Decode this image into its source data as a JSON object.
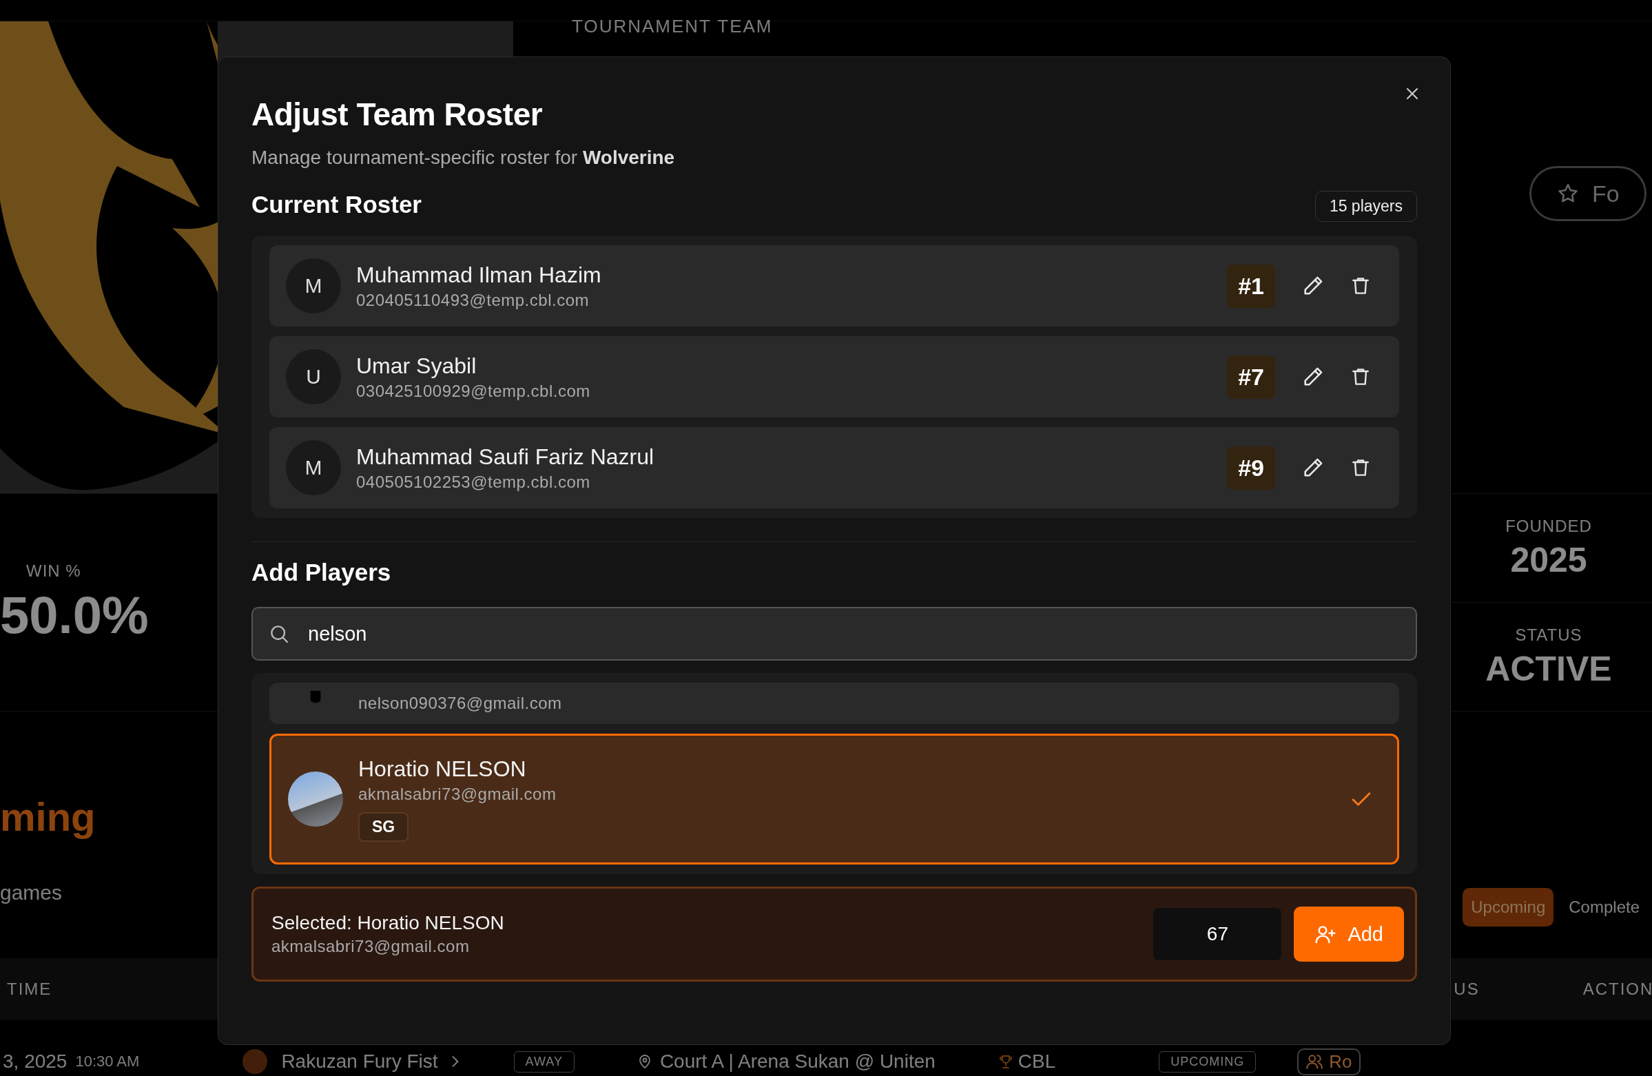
{
  "background": {
    "header_label": "TOURNAMENT TEAM",
    "follow_button": "Fo",
    "stats": [
      {
        "label": "WIN %",
        "value": "50.0%"
      },
      {
        "label": "FOUNDED",
        "value": "2025"
      },
      {
        "label": "STATUS",
        "value": "ACTIVE"
      }
    ],
    "games_heading": "ming",
    "games_subtitle": "games",
    "filter_tabs": [
      {
        "label": "Upcoming",
        "selected": true
      },
      {
        "label": "Complete",
        "selected": false
      }
    ],
    "table": {
      "columns": [
        "TIME",
        "US",
        "ACTION"
      ],
      "rows": [
        {
          "date": "3, 2025",
          "time": "10:30 AM",
          "opponent": "Rakuzan Fury Fist",
          "venue_type": "AWAY",
          "venue": "Court A | Arena Sukan @ Uniten",
          "league": "CBL",
          "status": "UPCOMING",
          "action": "Ro"
        }
      ]
    }
  },
  "dialog": {
    "title": "Adjust Team Roster",
    "subtitle": "Manage tournament-specific roster for **Wolverine**",
    "roster_heading": "Current Roster",
    "player_count": "15 players",
    "roster": [
      {
        "initial": "M",
        "name": "Muhammad Ilman Hazim",
        "email": "020405110493@temp.cbl.com",
        "number": "#1"
      },
      {
        "initial": "U",
        "name": "Umar Syabil",
        "email": "030425100929@temp.cbl.com",
        "number": "#7"
      },
      {
        "initial": "M",
        "name": "Muhammad Saufi Fariz Nazrul",
        "email": "040505102253@temp.cbl.com",
        "number": "#9"
      }
    ],
    "add_heading": "Add Players",
    "search": {
      "value": "nelson"
    },
    "results": [
      {
        "kind": "silhouette",
        "email": "nelson090376@gmail.com",
        "selected": false
      },
      {
        "kind": "photo",
        "name": "Horatio NELSON",
        "email": "akmalsabri73@gmail.com",
        "position": "SG",
        "selected": true
      }
    ],
    "selection": {
      "label": "Selected: Horatio NELSON",
      "email": "akmalsabri73@gmail.com",
      "jersey_number": "67",
      "add_button": "Add"
    }
  }
}
